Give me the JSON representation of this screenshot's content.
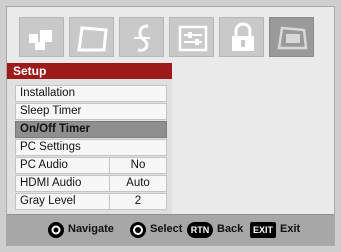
{
  "tabs": [
    {
      "icon": "picture-icon",
      "active": false
    },
    {
      "icon": "video-icon",
      "active": false
    },
    {
      "icon": "music-icon",
      "active": false
    },
    {
      "icon": "preferences-icon",
      "active": false
    },
    {
      "icon": "lock-icon",
      "active": false
    },
    {
      "icon": "setup-icon",
      "active": true
    }
  ],
  "panel": {
    "title": "Setup",
    "header_color": "#9c1a1a",
    "items": [
      {
        "label": "Installation",
        "value": "",
        "selected": false
      },
      {
        "label": "Sleep Timer",
        "value": "",
        "selected": false
      },
      {
        "label": "On/Off Timer",
        "value": "",
        "selected": true
      },
      {
        "label": "PC Settings",
        "value": "",
        "selected": false
      },
      {
        "label": "PC Audio",
        "value": "No",
        "selected": false
      },
      {
        "label": "HDMI Audio",
        "value": "Auto",
        "selected": false
      },
      {
        "label": "Gray Level",
        "value": "2",
        "selected": false
      }
    ]
  },
  "footer": {
    "navigate_label": "Navigate",
    "select_label": "Select",
    "back_key": "RTN",
    "back_label": "Back",
    "exit_key": "EXIT",
    "exit_label": "Exit"
  }
}
